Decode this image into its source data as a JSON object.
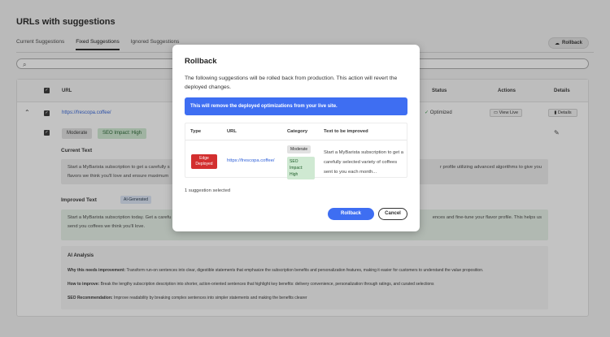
{
  "page": {
    "title": "URLs with suggestions",
    "tabs": [
      "Current Suggestions",
      "Fixed Suggestions",
      "Ignored Suggestions"
    ],
    "rollback_label": "Rollback",
    "table": {
      "headers": {
        "url": "URL",
        "status": "Status",
        "actions": "Actions",
        "details": "Details"
      },
      "row": {
        "url": "https://frescopa.coffee/",
        "status": "Optimized",
        "view_live": "View Live",
        "details": "Details",
        "badge_moderate": "Moderate",
        "badge_seo": "SEO Impact: High"
      },
      "current_text_title": "Current Text",
      "current_text_l1_a": "Start a MyBarista subscription to get a carefully s",
      "current_text_l1_b": "r profile utilizing advanced algorithms to give you",
      "current_text_l2": "flavors we think you'll love and ensure maximum",
      "improved_text_title": "Improved Text",
      "ai_generated": "AI-Generated",
      "improved_text_l1_a": "Start a MyBarista subscription today. Get a carefu",
      "improved_text_l1_b": "ences and fine-tune your flavor profile. This helps us",
      "improved_text_l2": "send you coffees we think you'll love.",
      "ai_analysis": {
        "title": "AI Analysis",
        "why_label": "Why this needs improvement:",
        "why": "Transform run-on sentences into clear, digestible statements that emphasize the subscription benefits and personalization features, making it easier for customers to understand the value proposition.",
        "how_label": "How to improve:",
        "how": "Break the lengthy subscription description into shorter, action-oriented sentences that highlight key benefits: delivery convenience, personalization through ratings, and curated selections",
        "seo_label": "SEO Recommendation:",
        "seo": "Improve readability by breaking complex sentences into simpler statements and making the benefits clearer"
      }
    }
  },
  "modal": {
    "title": "Rollback",
    "description": "The following suggestions will be rolled back from production. This action will revert the deployed changes.",
    "banner": "This will remove the deployed optimizations from your live site.",
    "headers": {
      "type": "Type",
      "url": "URL",
      "category": "Category",
      "text": "Text to be improved"
    },
    "row": {
      "type": "Edge Deployed",
      "url": "https://frescopa.coffee/",
      "category_moderate": "Moderate",
      "category_seo": "SEO Impact: High",
      "text": "Start a MyBarista subscription to get a carefully selected variety of coffees sent to you each month..."
    },
    "selected": "1 suggestion selected",
    "rollback_button": "Rollback",
    "cancel_button": "Cancel"
  },
  "colors": {
    "accent": "#3e6ef2",
    "edge_badge": "#d32f2f",
    "seo_green": "#cfe9d2"
  }
}
